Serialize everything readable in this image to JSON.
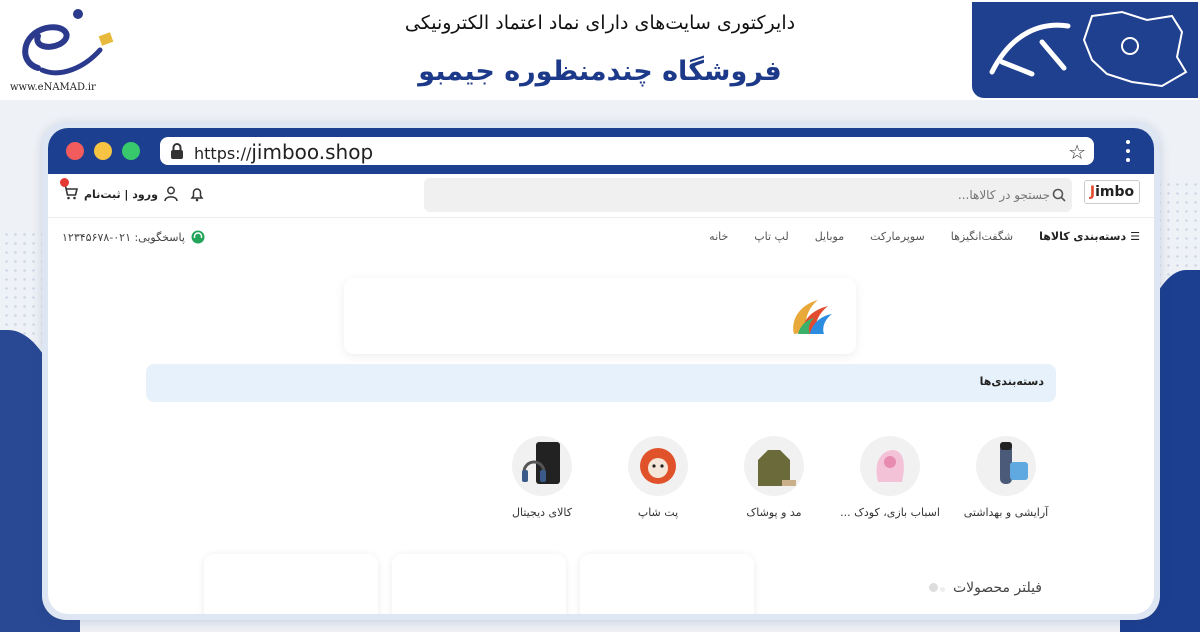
{
  "header": {
    "enamad_url": "www.eNAMAD.ir",
    "subtitle": "دایرکتوری سایت‌های دارای نماد اعتماد الکترونیکی",
    "title": "فروشگاه چندمنظوره جیمبو",
    "brand_color": "#1f3f8f"
  },
  "browser": {
    "url_protocol": "https://",
    "url_domain": "jimboo.shop"
  },
  "site": {
    "logo_j": "J",
    "logo_rest": "imbo",
    "search_placeholder": "جستجو در کالاها...",
    "auth_label": "ورود | ثبت‌نام",
    "nav": {
      "categories": "دسته‌بندی کالاها",
      "items": [
        "شگفت‌انگیزها",
        "سوپرمارکت",
        "موبایل",
        "لپ تاپ",
        "خانه"
      ]
    },
    "support": "پاسخگویی: ۰۲۱-۱۲۳۴۵۶۷۸",
    "category_bar": "دسته‌بندی‌ها",
    "categories": [
      {
        "label": "آرایشی و بهداشتی",
        "icon": "shaver-icon"
      },
      {
        "label": "اسباب بازی، کودک ...",
        "icon": "car-seat-icon"
      },
      {
        "label": "مد و پوشاک",
        "icon": "hoodie-icon"
      },
      {
        "label": "پت شاپ",
        "icon": "pet-icon"
      },
      {
        "label": "کالای دیجیتال",
        "icon": "headphones-icon"
      }
    ],
    "filter_title": "فیلتر محصولات"
  }
}
